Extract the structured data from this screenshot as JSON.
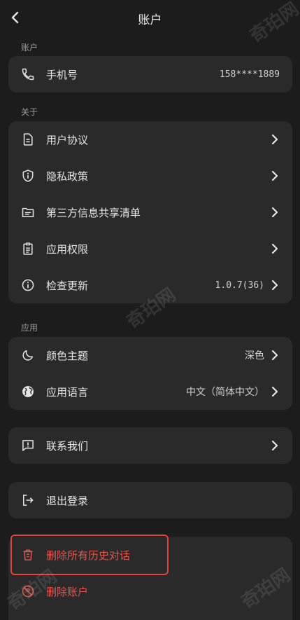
{
  "header": {
    "title": "账户"
  },
  "sections": {
    "account": "账户",
    "about": "关于",
    "app": "应用"
  },
  "account": {
    "phone_label": "手机号",
    "phone_value": "158****1889"
  },
  "about": {
    "items": [
      {
        "label": "用户协议"
      },
      {
        "label": "隐私政策"
      },
      {
        "label": "第三方信息共享清单"
      },
      {
        "label": "应用权限"
      },
      {
        "label": "检查更新",
        "value": "1.0.7(36)"
      }
    ]
  },
  "app": {
    "theme_label": "颜色主题",
    "theme_value": "深色",
    "language_label": "应用语言",
    "language_value": "中文（简体中文）"
  },
  "contact": {
    "label": "联系我们"
  },
  "logout": {
    "label": "退出登录"
  },
  "danger": {
    "delete_history_label": "删除所有历史对话",
    "delete_account_label": "删除账户"
  },
  "watermark": "奇珀网",
  "colors": {
    "background": "#1c1c1c",
    "card": "#2a2a2a",
    "danger": "#e2584f",
    "highlight": "#e2443c"
  }
}
